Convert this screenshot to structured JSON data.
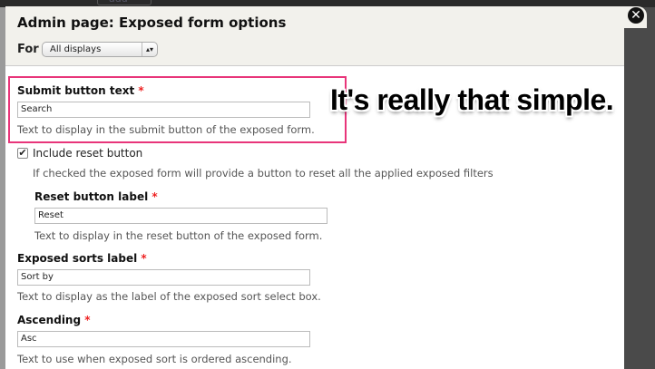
{
  "background": {
    "add_button": "add"
  },
  "modal": {
    "title": "Admin page: Exposed form options",
    "for_label": "For",
    "for_select": "All displays",
    "close_icon": "close-icon"
  },
  "fields": {
    "submit": {
      "label": "Submit button text",
      "required": "*",
      "value": "Search",
      "desc": "Text to display in the submit button of the exposed form."
    },
    "include_reset": {
      "label": "Include reset button",
      "checked": true,
      "desc": "If checked the exposed form will provide a button to reset all the applied exposed filters"
    },
    "reset_label": {
      "label": "Reset button label",
      "required": "*",
      "value": "Reset",
      "desc": "Text to display in the reset button of the exposed form."
    },
    "sorts_label": {
      "label": "Exposed sorts label",
      "required": "*",
      "value": "Sort by",
      "desc": "Text to display as the label of the exposed sort select box."
    },
    "ascending": {
      "label": "Ascending",
      "required": "*",
      "value": "Asc",
      "desc": "Text to use when exposed sort is ordered ascending."
    }
  },
  "annotation": {
    "text": "It's really that simple.",
    "color": "#e8357a"
  }
}
